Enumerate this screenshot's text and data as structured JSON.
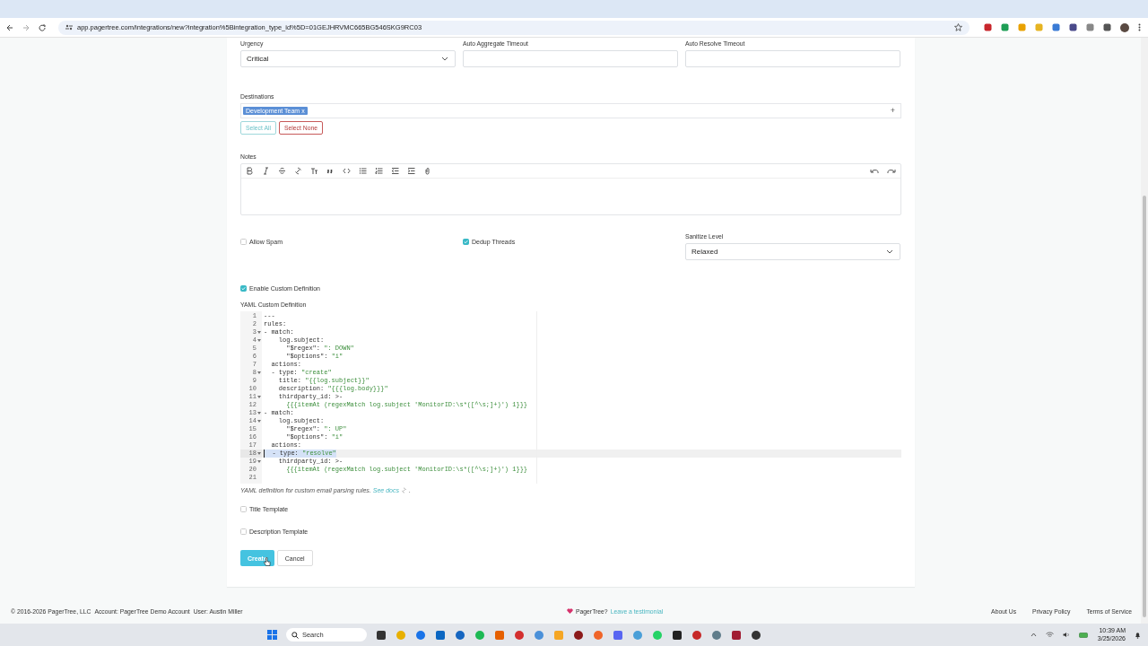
{
  "browser": {
    "url": "app.pagertree.com/integrations/new?integration%5Bintegration_type_id%5D=01GEJHRVMC665BG546SKG9RC03"
  },
  "form": {
    "urgency": {
      "label": "Urgency",
      "value": "Critical"
    },
    "auto_aggregate_timeout": {
      "label": "Auto Aggregate Timeout"
    },
    "auto_resolve_timeout": {
      "label": "Auto Resolve Timeout"
    },
    "destinations": {
      "label": "Destinations",
      "tags": [
        {
          "label": "Development Team",
          "remove": "x"
        }
      ],
      "add": "+"
    },
    "select_all": "Select All",
    "select_none": "Select None",
    "notes": {
      "label": "Notes"
    },
    "options": [
      {
        "label": "Allow Spam",
        "checked": false
      },
      {
        "label": "Dedup Threads",
        "checked": true
      }
    ],
    "sanitize_level": {
      "label": "Sanitize Level",
      "value": "Relaxed"
    },
    "enable_custom_definition": {
      "label": "Enable Custom Definition",
      "checked": true
    },
    "yaml": {
      "label": "YAML Custom Definition",
      "lines": [
        {
          "n": "1",
          "code": "---",
          "fold": false,
          "selected": false
        },
        {
          "n": "2",
          "code": "rules:",
          "fold": false,
          "selected": false
        },
        {
          "n": "3",
          "code": "- match:",
          "fold": true,
          "selected": false
        },
        {
          "n": "4",
          "code": "    log.subject:",
          "fold": true,
          "selected": false
        },
        {
          "n": "5",
          "code": "      \"$regex\": ",
          "str": "\": DOWN\"",
          "fold": false,
          "selected": false
        },
        {
          "n": "6",
          "code": "      \"$options\": ",
          "str": "\"i\"",
          "fold": false,
          "selected": false
        },
        {
          "n": "7",
          "code": "  actions:",
          "fold": false,
          "selected": false
        },
        {
          "n": "8",
          "code": "  - type: ",
          "str": "\"create\"",
          "fold": true,
          "selected": false
        },
        {
          "n": "9",
          "code": "    title: ",
          "str": "\"{{log.subject}}\"",
          "fold": false,
          "selected": false
        },
        {
          "n": "10",
          "code": "    description: ",
          "str": "\"{{{log.body}}}\"",
          "fold": false,
          "selected": false
        },
        {
          "n": "11",
          "code": "    thirdparty_id: >-",
          "fold": true,
          "selected": false
        },
        {
          "n": "12",
          "str": "      {{{itemAt (regexMatch log.subject 'MonitorID:\\s*([^\\s;]+)') 1}}}",
          "fold": false,
          "selected": false
        },
        {
          "n": "13",
          "code": "- match:",
          "fold": true,
          "selected": false
        },
        {
          "n": "14",
          "code": "    log.subject:",
          "fold": true,
          "selected": false
        },
        {
          "n": "15",
          "code": "      \"$regex\": ",
          "str": "\": UP\"",
          "fold": false,
          "selected": false
        },
        {
          "n": "16",
          "code": "      \"$options\": ",
          "str": "\"i\"",
          "fold": false,
          "selected": false
        },
        {
          "n": "17",
          "code": "  actions:",
          "fold": false,
          "selected": false
        },
        {
          "n": "18",
          "code": "  - type: ",
          "str": "\"resolve\"",
          "fold": true,
          "selected": true
        },
        {
          "n": "19",
          "code": "    thirdparty_id: >-",
          "fold": true,
          "selected": false
        },
        {
          "n": "20",
          "str": "      {{{itemAt (regexMatch log.subject 'MonitorID:\\s*([^\\s;]+)') 1}}}",
          "fold": false,
          "selected": false
        },
        {
          "n": "21",
          "fold": false,
          "selected": false
        }
      ],
      "help": "YAML definition for custom email parsing rules.",
      "link": "See docs",
      "suffix": "."
    },
    "templates": [
      {
        "label": "Title Template",
        "checked": false
      },
      {
        "label": "Description Template",
        "checked": false
      }
    ],
    "buttons": [
      {
        "label": "Create",
        "kind": "primary"
      },
      {
        "label": "Cancel",
        "kind": "secondary"
      }
    ]
  },
  "footer": {
    "copyright": "© 2016-2026 PagerTree, LLC",
    "account": "Account: PagerTree Demo Account",
    "user": "User: Austin Miller",
    "promo": "PagerTree?",
    "testimonial": "Leave a testimonial",
    "links": [
      "About Us",
      "Privacy Policy",
      "Terms of Service"
    ]
  },
  "taskbar": {
    "search": "Search",
    "time": "10:39 AM",
    "date": "3/25/2026"
  }
}
